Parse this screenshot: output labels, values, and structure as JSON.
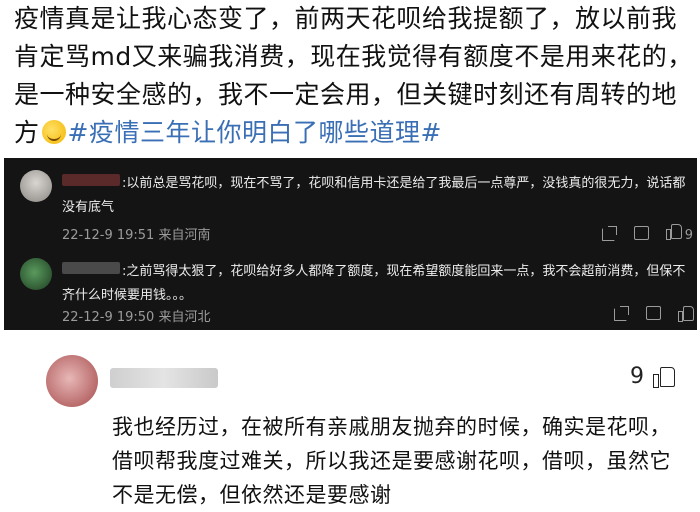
{
  "post": {
    "text": "疫情真是让我心态变了，前两天花呗给我提额了，放以前我肯定骂md又来骗我消费，现在我觉得有额度不是用来花的，是一种安全感的，我不一定会用，但关键时刻还有周转的地方",
    "emoji": "crying-laughing-emoji",
    "hashtag": "#疫情三年让你明白了哪些道理#"
  },
  "dark_comments": [
    {
      "name_suffix": ":",
      "text": "以前总是骂花呗，现在不骂了，花呗和信用卡还是给了我最后一点尊严，没钱真的很无力，说话都没有底气",
      "meta": "22-12-9 19:51 来自河南",
      "like_count": "9"
    },
    {
      "name_suffix": ":",
      "text": "之前骂得太狠了，花呗给好多人都降了额度，现在希望额度能回来一点，我不会超前消费，但保不齐什么时候要用钱。。。",
      "meta": "22-12-9 19:50 来自河北",
      "like_count": ""
    }
  ],
  "main_comment": {
    "like_count": "9",
    "text": "我也经历过，在被所有亲戚朋友抛弃的时候，确实是花呗，借呗帮我度过难关，所以我还是要感谢花呗，借呗，虽然它不是无偿，但依然还是要感谢"
  }
}
